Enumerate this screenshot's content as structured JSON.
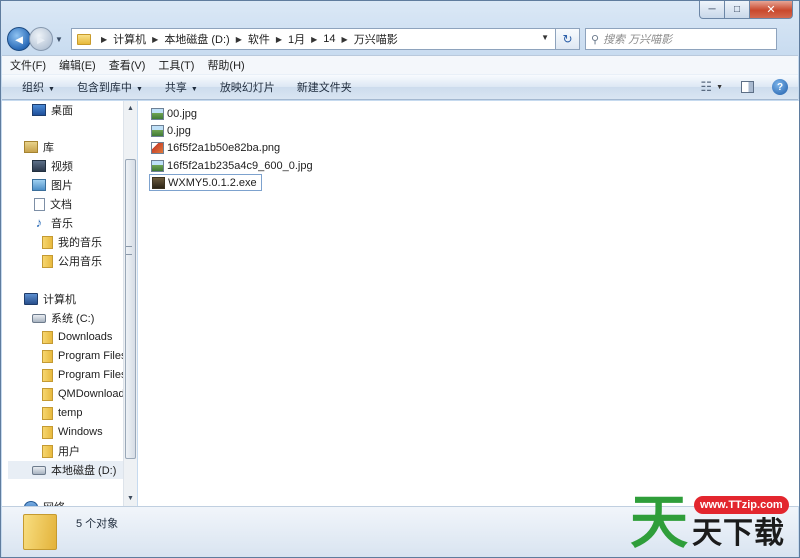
{
  "window": {
    "caption_min": "─",
    "caption_max": "□",
    "caption_close": "✕"
  },
  "nav": {
    "back_glyph": "◄",
    "forward_glyph": "►",
    "breadcrumbs": [
      "计算机",
      "本地磁盘 (D:)",
      "软件",
      "1月",
      "14",
      "万兴喵影"
    ],
    "search_placeholder": "搜索 万兴喵影"
  },
  "menubar": {
    "items": [
      "文件(F)",
      "编辑(E)",
      "查看(V)",
      "工具(T)",
      "帮助(H)"
    ]
  },
  "commandbar": {
    "organize": "组织",
    "include_library": "包含到库中",
    "share": "共享",
    "slideshow": "放映幻灯片",
    "new_folder": "新建文件夹"
  },
  "navpane": {
    "desktop": "桌面",
    "libraries": "库",
    "videos": "视频",
    "pictures": "图片",
    "documents": "文档",
    "music": "音乐",
    "my_music": "我的音乐",
    "public_music": "公用音乐",
    "computer": "计算机",
    "system_c": "系统 (C:)",
    "downloads": "Downloads",
    "program_files_1": "Program Files",
    "program_files_2": "Program Files",
    "qmdownload": "QMDownload",
    "temp": "temp",
    "windows": "Windows",
    "users": "用户",
    "local_d": "本地磁盘 (D:)",
    "network": "网络"
  },
  "files": [
    {
      "name": "00.jpg",
      "type": "jpg"
    },
    {
      "name": "0.jpg",
      "type": "jpg"
    },
    {
      "name": "16f5f2a1b50e82ba.png",
      "type": "png"
    },
    {
      "name": "16f5f2a1b235a4c9_600_0.jpg",
      "type": "jpg"
    },
    {
      "name": "WXMY5.0.1.2.exe",
      "type": "exe"
    }
  ],
  "status": {
    "count_text": "5 个对象"
  },
  "watermark": {
    "big_char": "天",
    "url": "www.TTzip.com",
    "sub": "天下载"
  }
}
